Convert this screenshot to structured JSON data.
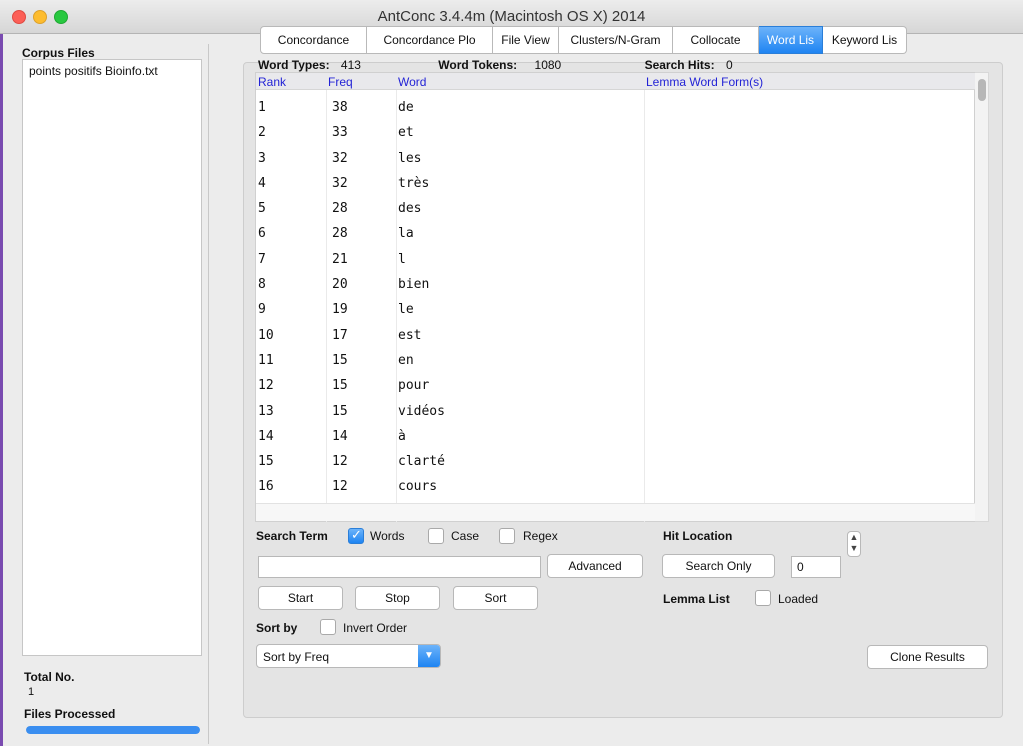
{
  "window": {
    "title": "AntConc 3.4.4m (Macintosh OS X) 2014"
  },
  "sidebar": {
    "corpus_label": "Corpus Files",
    "files": [
      "points positifs Bioinfo.txt"
    ],
    "total_label": "Total No.",
    "total_value": "1",
    "processed_label": "Files Processed",
    "progress_fraction": 1.0
  },
  "tabs": [
    {
      "label": "Concordance",
      "active": false
    },
    {
      "label": "Concordance Plo",
      "active": false
    },
    {
      "label": "File View",
      "active": false
    },
    {
      "label": "Clusters/N-Gram",
      "active": false
    },
    {
      "label": "Collocate",
      "active": false
    },
    {
      "label": "Word Lis",
      "active": true
    },
    {
      "label": "Keyword Lis",
      "active": false
    }
  ],
  "stats": {
    "word_types_label": "Word Types:",
    "word_types": "413",
    "word_tokens_label": "Word Tokens:",
    "word_tokens": "1080",
    "search_hits_label": "Search Hits:",
    "search_hits": "0"
  },
  "table": {
    "headers": {
      "rank": "Rank",
      "freq": "Freq",
      "word": "Word",
      "lemma": "Lemma Word Form(s)"
    },
    "rows": [
      {
        "rank": "1",
        "freq": "38",
        "word": "de"
      },
      {
        "rank": "2",
        "freq": "33",
        "word": "et"
      },
      {
        "rank": "3",
        "freq": "32",
        "word": "les"
      },
      {
        "rank": "4",
        "freq": "32",
        "word": "très"
      },
      {
        "rank": "5",
        "freq": "28",
        "word": "des"
      },
      {
        "rank": "6",
        "freq": "28",
        "word": "la"
      },
      {
        "rank": "7",
        "freq": "21",
        "word": "l"
      },
      {
        "rank": "8",
        "freq": "20",
        "word": "bien"
      },
      {
        "rank": "9",
        "freq": "19",
        "word": "le"
      },
      {
        "rank": "10",
        "freq": "17",
        "word": "est"
      },
      {
        "rank": "11",
        "freq": "15",
        "word": "en"
      },
      {
        "rank": "12",
        "freq": "15",
        "word": "pour"
      },
      {
        "rank": "13",
        "freq": "15",
        "word": "vidéos"
      },
      {
        "rank": "14",
        "freq": "14",
        "word": "à"
      },
      {
        "rank": "15",
        "freq": "12",
        "word": "clarté"
      },
      {
        "rank": "16",
        "freq": "12",
        "word": "cours"
      }
    ]
  },
  "controls": {
    "search_term_label": "Search Term",
    "words_label": "Words",
    "words_checked": true,
    "case_label": "Case",
    "case_checked": false,
    "regex_label": "Regex",
    "regex_checked": false,
    "search_value": "",
    "advanced_label": "Advanced",
    "hit_location_label": "Hit Location",
    "search_only_label": "Search Only",
    "hit_location_value": "0",
    "start_label": "Start",
    "stop_label": "Stop",
    "sort_label": "Sort",
    "lemma_list_label": "Lemma List",
    "loaded_label": "Loaded",
    "loaded_checked": false,
    "sort_by_label": "Sort by",
    "invert_order_label": "Invert Order",
    "invert_checked": false,
    "sort_select_value": "Sort by Freq",
    "clone_results_label": "Clone Results"
  }
}
